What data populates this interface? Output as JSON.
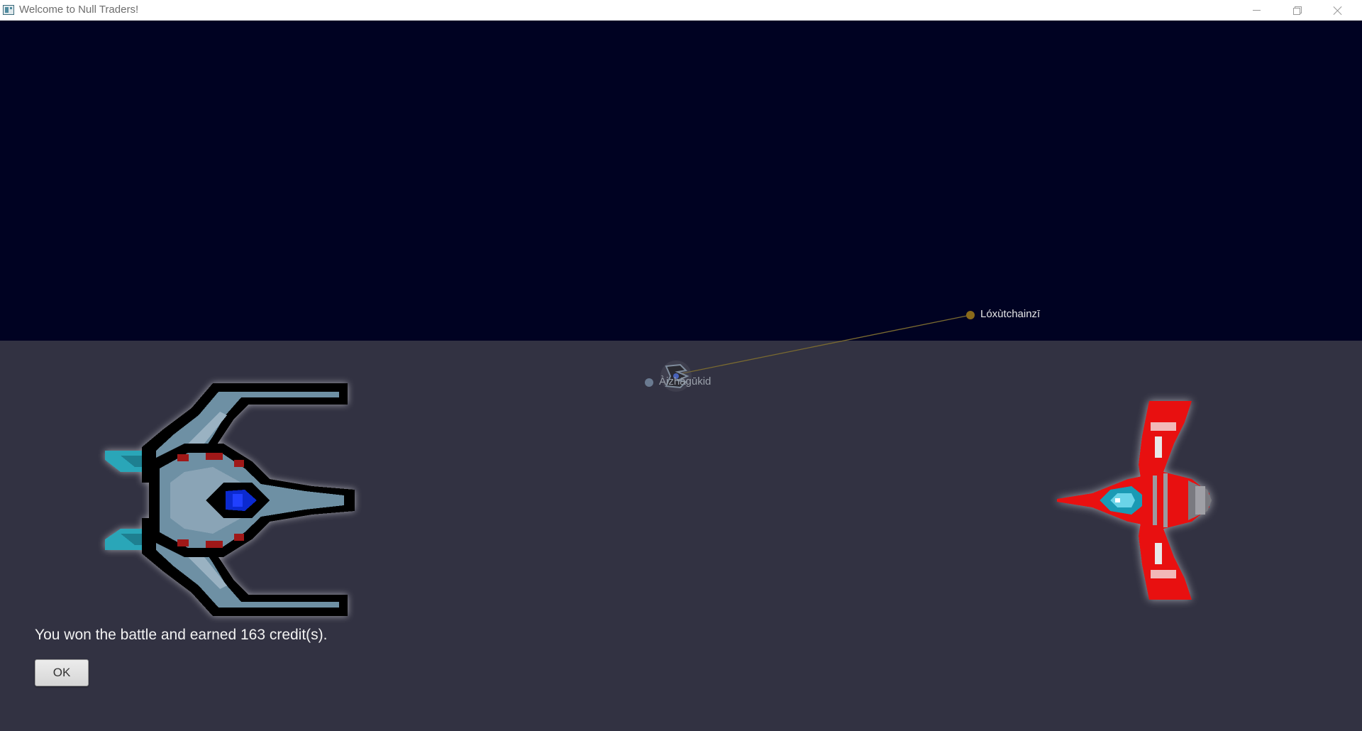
{
  "window": {
    "title": "Welcome to Null Traders!",
    "icons": {
      "app": "app-icon",
      "minimize": "minimize-icon",
      "maximize": "restore-icon",
      "close": "close-icon"
    }
  },
  "map": {
    "background_color": "#000222",
    "planets": [
      {
        "name": "Lóxùtchainzī",
        "color": "#8a6a1a"
      },
      {
        "name": "Àizhāgūkid",
        "color": "#6a7a90"
      }
    ],
    "route_color": "#7a6a30"
  },
  "battle": {
    "background_color": "#323242",
    "message": "You won the battle and earned 163 credit(s).",
    "ok_label": "OK",
    "player_ship": "player-ship-icon",
    "enemy_ship": "enemy-ship-icon"
  }
}
